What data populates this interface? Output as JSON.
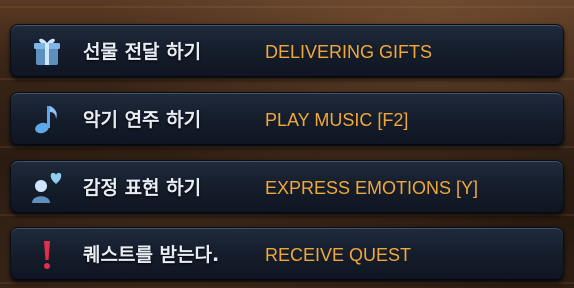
{
  "menu": {
    "items": [
      {
        "icon": "gift-icon",
        "korean": "선물 전달 하기",
        "english": "DELIVERING GIFTS"
      },
      {
        "icon": "music-note-icon",
        "korean": "악기 연주 하기",
        "english": "PLAY MUSIC [F2]"
      },
      {
        "icon": "emotion-heart-person-icon",
        "korean": "감정 표현 하기",
        "english": "EXPRESS EMOTIONS [Y]"
      },
      {
        "icon": "exclamation-icon",
        "korean": "퀘스트를 받는다.",
        "english": "RECEIVE QUEST"
      }
    ]
  },
  "colors": {
    "translation_text": "#f0a83a",
    "korean_text": "#e8edf5",
    "button_bg": "#141c2a",
    "gift_icon": "#7fb6e6",
    "note_icon": "#5fa8e8",
    "heart_icon": "#8fd0f0",
    "exclamation_icon": "#e0304a"
  }
}
